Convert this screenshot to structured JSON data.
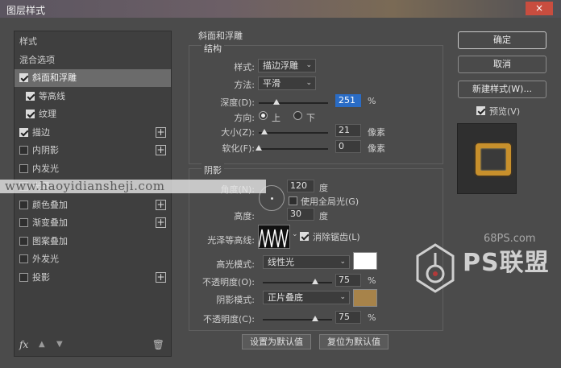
{
  "window": {
    "title": "图层样式",
    "close_icon": "×"
  },
  "left_panel": {
    "items": [
      {
        "label": "样式",
        "checkbox": false,
        "has_plus": false
      },
      {
        "label": "混合选项",
        "checkbox": false,
        "has_plus": false
      },
      {
        "label": "斜面和浮雕",
        "checkbox": true,
        "checked": true,
        "active": true,
        "has_plus": false
      },
      {
        "label": "等高线",
        "checkbox": true,
        "checked": true,
        "sub": true,
        "has_plus": false
      },
      {
        "label": "纹理",
        "checkbox": true,
        "checked": true,
        "sub": true,
        "has_plus": false
      },
      {
        "label": "描边",
        "checkbox": true,
        "checked": true,
        "has_plus": true
      },
      {
        "label": "内阴影",
        "checkbox": true,
        "checked": false,
        "has_plus": true
      },
      {
        "label": "内发光",
        "checkbox": true,
        "checked": false,
        "has_plus": false
      },
      {
        "label": "光泽",
        "checkbox": true,
        "checked": false,
        "has_plus": false
      },
      {
        "label": "颜色叠加",
        "checkbox": true,
        "checked": false,
        "has_plus": true
      },
      {
        "label": "渐变叠加",
        "checkbox": true,
        "checked": false,
        "has_plus": true
      },
      {
        "label": "图案叠加",
        "checkbox": true,
        "checked": false,
        "has_plus": false
      },
      {
        "label": "外发光",
        "checkbox": true,
        "checked": false,
        "has_plus": false
      },
      {
        "label": "投影",
        "checkbox": true,
        "checked": false,
        "has_plus": true
      }
    ],
    "footer": {
      "fx_label": "fx",
      "trash_icon": "🗑"
    }
  },
  "bevel": {
    "group_title": "斜面和浮雕",
    "structure_title": "结构",
    "style_label": "样式:",
    "style_value": "描边浮雕",
    "method_label": "方法:",
    "method_value": "平滑",
    "depth_label": "深度(D):",
    "depth_value": "251",
    "depth_unit": "%",
    "depth_level": 0.25,
    "direction_label": "方向:",
    "direction_up": "上",
    "direction_down": "下",
    "size_label": "大小(Z):",
    "size_value": "21",
    "size_unit": "像素",
    "size_level": 0.08,
    "soften_label": "软化(F):",
    "soften_value": "0",
    "soften_unit": "像素",
    "soften_level": 0.0
  },
  "shading": {
    "title": "阴影",
    "angle_label": "角度(N):",
    "angle_value": "120",
    "angle_unit": "度",
    "global_light_label": "使用全局光(G)",
    "altitude_label": "高度:",
    "altitude_value": "30",
    "altitude_unit": "度",
    "gloss_contour_label": "光泽等高线:",
    "antialias_label": "消除锯齿(L)",
    "highlight_mode_label": "高光模式:",
    "highlight_mode_value": "线性光",
    "highlight_color": "#ffffff",
    "highlight_opacity_label": "不透明度(O):",
    "highlight_opacity_value": "75",
    "highlight_opacity_unit": "%",
    "highlight_opacity_level": 0.75,
    "shadow_mode_label": "阴影模式:",
    "shadow_mode_value": "正片叠底",
    "shadow_color": "#a7834a",
    "shadow_opacity_label": "不透明度(C):",
    "shadow_opacity_value": "75",
    "shadow_opacity_unit": "%",
    "shadow_opacity_level": 0.75
  },
  "bottom_buttons": {
    "set_default": "设置为默认值",
    "reset_default": "复位为默认值"
  },
  "right_panel": {
    "ok": "确定",
    "cancel": "取消",
    "new_style": "新建样式(W)...",
    "preview_label": "预览(V)"
  },
  "watermark_text": "www.haoyidiansheji.com",
  "logo": {
    "site": "68PS.com",
    "brand": "PS联盟"
  }
}
